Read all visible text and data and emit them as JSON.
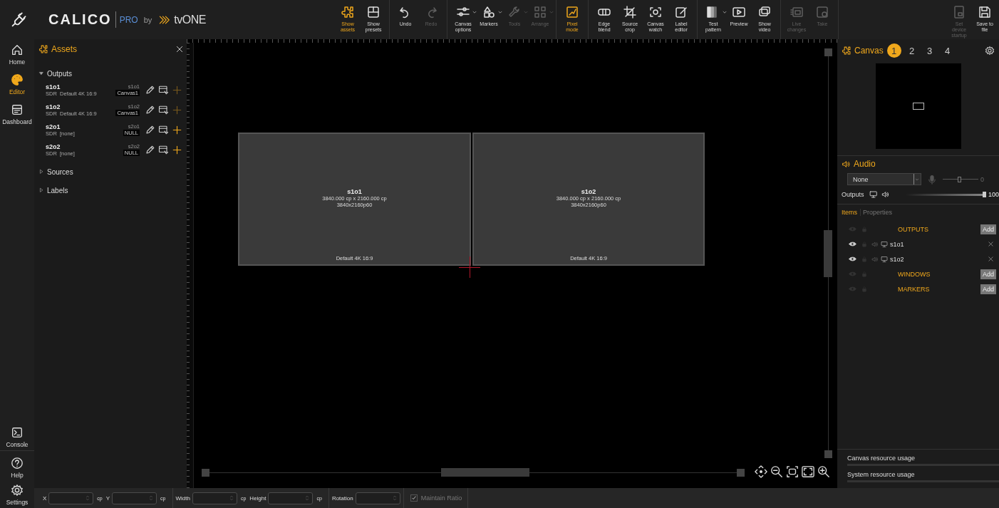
{
  "logo": {
    "product": "CALICO",
    "edition": "PRO",
    "by": "by",
    "brand": "tvONE"
  },
  "toolbar": {
    "groups": [
      {
        "items": [
          {
            "label": "Show assets",
            "active": true,
            "disabled": false,
            "dropdown": false
          },
          {
            "label": "Show presets",
            "active": false,
            "disabled": false,
            "dropdown": false
          }
        ]
      },
      {
        "items": [
          {
            "label": "Undo",
            "active": false,
            "disabled": false,
            "dropdown": false
          },
          {
            "label": "Redo",
            "active": false,
            "disabled": true,
            "dropdown": false
          }
        ]
      },
      {
        "items": [
          {
            "label": "Canvas options",
            "active": false,
            "disabled": false,
            "dropdown": true
          },
          {
            "label": "Markers",
            "active": false,
            "disabled": false,
            "dropdown": true
          },
          {
            "label": "Tools",
            "active": false,
            "disabled": true,
            "dropdown": true
          },
          {
            "label": "Arrange",
            "active": false,
            "disabled": true,
            "dropdown": true
          }
        ]
      },
      {
        "items": [
          {
            "label": "Pixel mode",
            "active": true,
            "disabled": false,
            "dropdown": false
          }
        ]
      },
      {
        "items": [
          {
            "label": "Edge blend",
            "active": false,
            "disabled": false,
            "dropdown": false
          },
          {
            "label": "Source crop",
            "active": false,
            "disabled": false,
            "dropdown": false
          },
          {
            "label": "Canvas watch",
            "active": false,
            "disabled": false,
            "dropdown": false
          },
          {
            "label": "Label editor",
            "active": false,
            "disabled": false,
            "dropdown": false
          }
        ]
      },
      {
        "items": [
          {
            "label": "Test pattern",
            "active": false,
            "disabled": false,
            "dropdown": true
          },
          {
            "label": "Preview",
            "active": false,
            "disabled": false,
            "dropdown": false
          },
          {
            "label": "Show video",
            "active": false,
            "disabled": false,
            "dropdown": false
          }
        ]
      },
      {
        "items": [
          {
            "label": "Live changes",
            "active": false,
            "disabled": true,
            "dropdown": false
          },
          {
            "label": "Take",
            "active": false,
            "disabled": true,
            "dropdown": false
          }
        ]
      }
    ],
    "right": [
      {
        "label": "Set device startup",
        "active": false,
        "disabled": true,
        "dropdown": false
      },
      {
        "label": "Save to file",
        "active": false,
        "disabled": false,
        "dropdown": false
      }
    ]
  },
  "nav": {
    "top": [
      {
        "label": "Home",
        "selected": false
      },
      {
        "label": "Editor",
        "selected": true
      },
      {
        "label": "Dashboard",
        "selected": false
      }
    ],
    "bottom": [
      {
        "label": "Console",
        "selected": false
      },
      {
        "label": "Help",
        "selected": false
      },
      {
        "label": "Settings",
        "selected": false
      }
    ]
  },
  "assets": {
    "title": "Assets",
    "tree": [
      {
        "label": "Outputs",
        "expanded": true,
        "children": [
          {
            "name": "s1o1",
            "info": "SDR  Default 4K 16:9",
            "id": "s1o1",
            "canvas": "Canvas1",
            "addable": false
          },
          {
            "name": "s1o2",
            "info": "SDR  Default 4K 16:9",
            "id": "s1o2",
            "canvas": "Canvas1",
            "addable": false
          },
          {
            "name": "s2o1",
            "info": "SDR  [none]",
            "id": "s2o1",
            "canvas": "NULL",
            "addable": true
          },
          {
            "name": "s2o2",
            "info": "SDR  [none]",
            "id": "s2o2",
            "canvas": "NULL",
            "addable": true
          }
        ]
      },
      {
        "label": "Sources",
        "expanded": false
      },
      {
        "label": "Labels",
        "expanded": false
      }
    ]
  },
  "canvas": {
    "outputs": [
      {
        "name": "s1o1",
        "size": "3840.000 cp x 2160.000 cp",
        "format": "3840x2160p60",
        "preset": "Default 4K 16:9"
      },
      {
        "name": "s1o2",
        "size": "3840.000 cp x 2160.000 cp",
        "format": "3840x2160p60",
        "preset": "Default 4K 16:9"
      }
    ]
  },
  "right_panel": {
    "title": "Canvas",
    "canvas_tabs": [
      {
        "label": "1",
        "selected": true
      },
      {
        "label": "2",
        "selected": false
      },
      {
        "label": "3",
        "selected": false
      },
      {
        "label": "4",
        "selected": false
      }
    ],
    "audio": {
      "title": "Audio",
      "source": "None",
      "input": {
        "level": 0.5,
        "reading": "0"
      },
      "outputs_label": "Outputs",
      "output": {
        "level": 1.0,
        "reading": "100"
      }
    },
    "tabs": [
      {
        "label": "Items",
        "selected": true
      },
      {
        "label": "Properties",
        "selected": false
      }
    ],
    "items": [
      {
        "kind": "group",
        "label": "OUTPUTS",
        "visible": false,
        "action": "Add"
      },
      {
        "kind": "output",
        "label": "s1o1",
        "visible": true
      },
      {
        "kind": "output",
        "label": "s1o2",
        "visible": true
      },
      {
        "kind": "group",
        "label": "WINDOWS",
        "visible": false,
        "action": "Add"
      },
      {
        "kind": "group",
        "label": "MARKERS",
        "visible": false,
        "action": "Add"
      }
    ],
    "usage": [
      {
        "label": "Canvas resource usage"
      },
      {
        "label": "System resource usage"
      }
    ]
  },
  "bottom_bar": {
    "groups": [
      {
        "fields": [
          {
            "label": "X",
            "unit": "cp"
          },
          {
            "label": "Y",
            "unit": "cp"
          }
        ]
      },
      {
        "fields": [
          {
            "label": "Width",
            "unit": "cp"
          },
          {
            "label": "Height",
            "unit": "cp"
          }
        ]
      },
      {
        "fields": [
          {
            "label": "Rotation"
          }
        ]
      }
    ],
    "maintain_ratio": {
      "label": "Maintain Ratio",
      "checked": true,
      "disabled": true
    }
  }
}
